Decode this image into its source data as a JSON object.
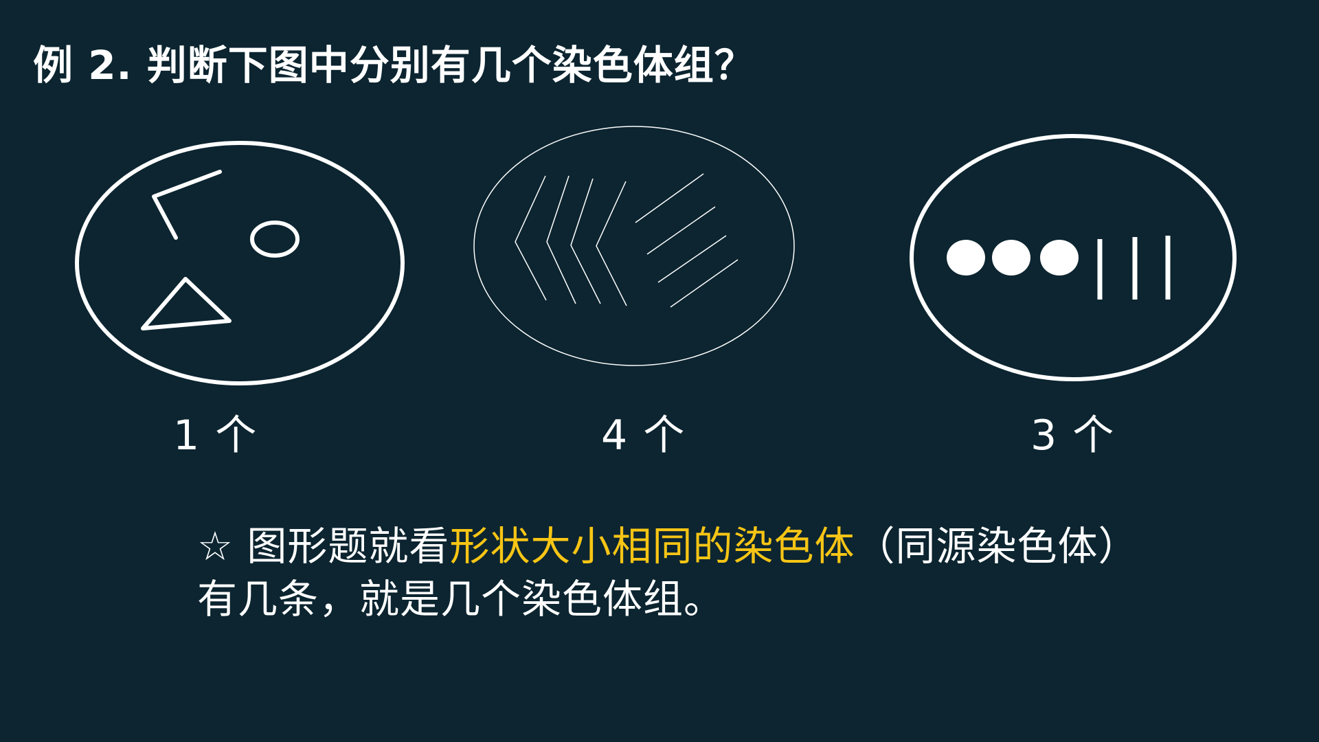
{
  "slide": {
    "title": "例 2. 判断下图中分别有几个染色体组？",
    "figures": [
      {
        "name": "cell-1",
        "answer": "1 个"
      },
      {
        "name": "cell-2",
        "answer": "4 个"
      },
      {
        "name": "cell-3",
        "answer": "3 个"
      }
    ],
    "tip": {
      "prefix": "☆ 图形题就看",
      "highlight": "形状大小相同的染色体",
      "suffix": "（同源染色体）有几条，就是几个染色体组。"
    },
    "colors": {
      "background": "#0c2530",
      "text": "#ffffff",
      "highlight": "#f7c515"
    }
  }
}
